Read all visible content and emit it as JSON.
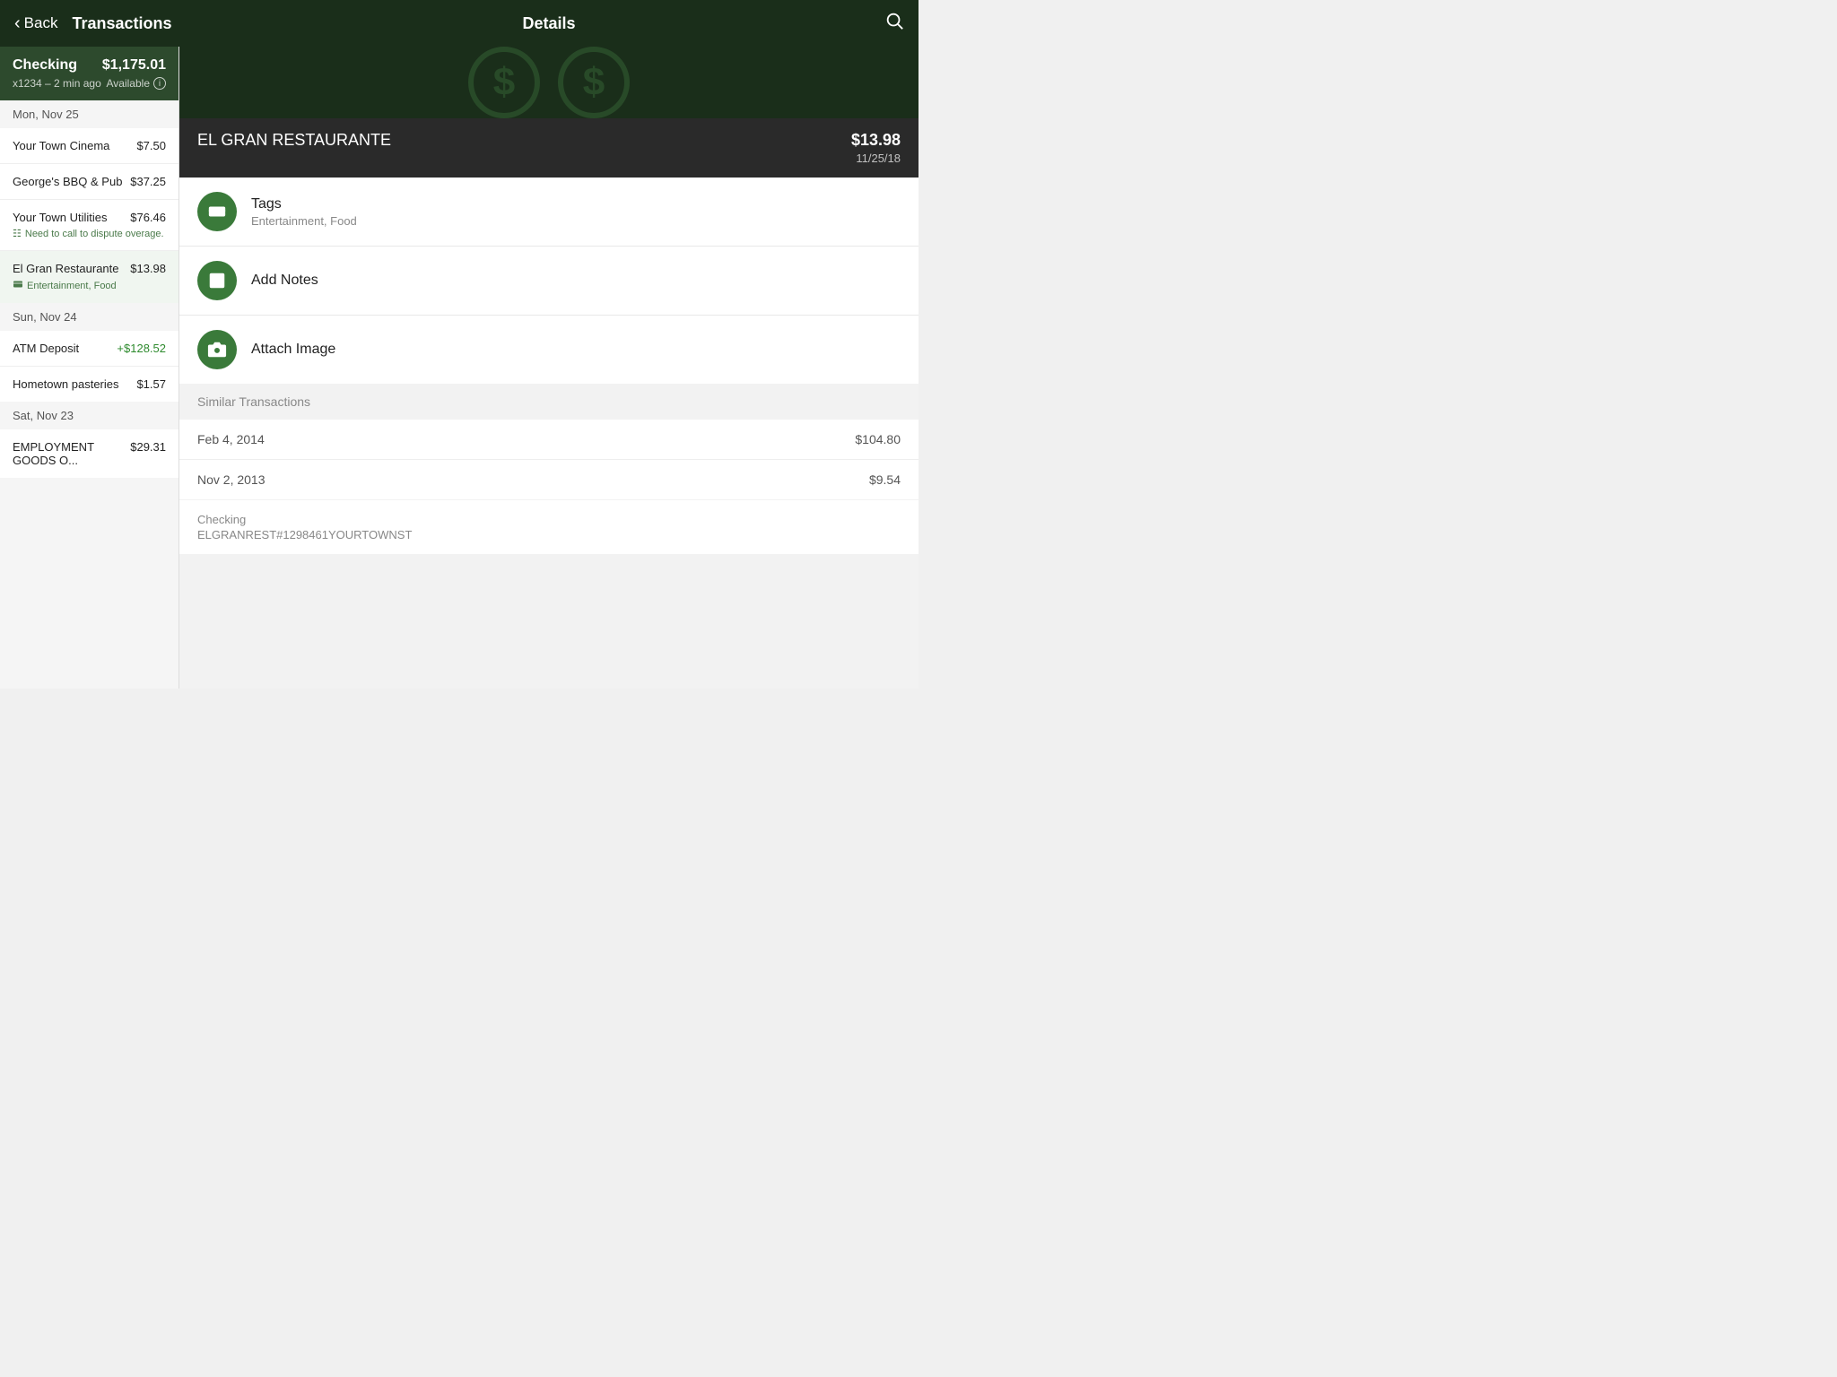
{
  "nav": {
    "back_label": "Back",
    "title": "Transactions",
    "details_title": "Details"
  },
  "account": {
    "name": "Checking",
    "number": "x1234",
    "last_updated": "2 min ago",
    "balance": "$1,175.01",
    "available_label": "Available"
  },
  "date_groups": [
    {
      "date": "Mon, Nov 25",
      "transactions": [
        {
          "id": "t1",
          "name": "Your Town Cinema",
          "amount": "$7.50",
          "positive": false,
          "note": null,
          "tag": null
        },
        {
          "id": "t2",
          "name": "George's BBQ & Pub",
          "amount": "$37.25",
          "positive": false,
          "note": null,
          "tag": null
        },
        {
          "id": "t3",
          "name": "Your Town Utilities",
          "amount": "$76.46",
          "positive": false,
          "note": "Need to call to dispute overage.",
          "tag": null
        },
        {
          "id": "t4",
          "name": "El Gran Restaurante",
          "amount": "$13.98",
          "positive": false,
          "note": null,
          "tag": "Entertainment, Food",
          "active": true
        }
      ]
    },
    {
      "date": "Sun, Nov 24",
      "transactions": [
        {
          "id": "t5",
          "name": "ATM Deposit",
          "amount": "+$128.52",
          "positive": true,
          "note": null,
          "tag": null
        },
        {
          "id": "t6",
          "name": "Hometown pasteries",
          "amount": "$1.57",
          "positive": false,
          "note": null,
          "tag": null
        }
      ]
    },
    {
      "date": "Sat, Nov 23",
      "transactions": [
        {
          "id": "t7",
          "name": "EMPLOYMENT GOODS O...",
          "amount": "$29.31",
          "positive": false,
          "note": null,
          "tag": null
        }
      ]
    }
  ],
  "details": {
    "merchant": "EL GRAN RESTAURANTE",
    "amount": "$13.98",
    "date": "11/25/18",
    "tags_label": "Tags",
    "tags_value": "Entertainment, Food",
    "add_notes_label": "Add Notes",
    "attach_image_label": "Attach Image",
    "similar_header": "Similar Transactions",
    "similar_transactions": [
      {
        "date": "Feb 4, 2014",
        "amount": "$104.80"
      },
      {
        "date": "Nov 2, 2013",
        "amount": "$9.54"
      }
    ],
    "account_label": "Checking",
    "account_ref": "ELGRANREST#1298461YOURTOWNST"
  }
}
